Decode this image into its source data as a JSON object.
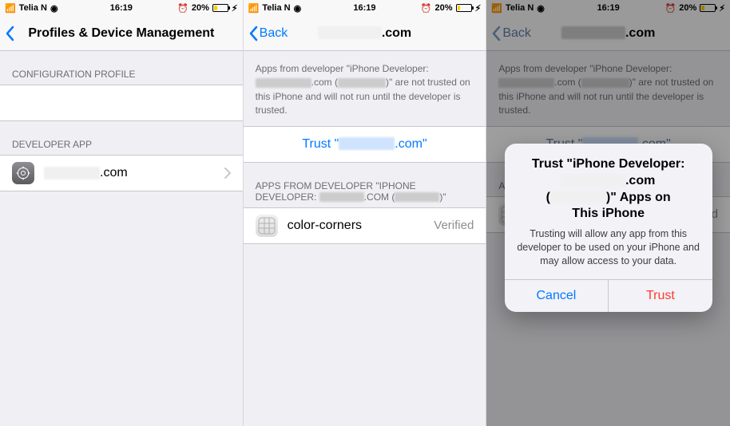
{
  "statusbar": {
    "carrier": "Telia N",
    "time": "16:19",
    "alarm": "⏰",
    "battery_pct": "20%",
    "charging": "⚡︎"
  },
  "screen1": {
    "title": "Profiles & Device Management",
    "section_profile": "CONFIGURATION PROFILE",
    "section_devapp": "DEVELOPER APP",
    "devapp_suffix": ".com"
  },
  "screen2": {
    "back": "Back",
    "title_suffix": ".com",
    "descr_pre": "Apps from developer \"iPhone Developer:",
    "descr_mid_suffix": ".com",
    "descr_paren_open": "(",
    "descr_mid_close": ")\" are not trusted on this iPhone and will not run until the developer is trusted.",
    "trust_pre": "Trust \"",
    "trust_suffix": ".com\"",
    "apps_header_pre": "APPS FROM DEVELOPER \"IPHONE DEVELOPER:",
    "apps_header_suf": ".COM (",
    "apps_header_end": ")\"",
    "app_name": "color-corners",
    "verified": "Verified"
  },
  "screen3": {
    "back": "Back",
    "title_suffix": ".com",
    "apps_header_short": "APPS",
    "verified": "Verified",
    "alert_title_l1": "Trust \"iPhone Developer:",
    "alert_title_l2_suffix": ".com",
    "alert_title_paren_open": "(",
    "alert_title_paren_close": ")\" Apps on",
    "alert_title_l4": "This iPhone",
    "alert_msg": "Trusting will allow any app from this developer to be used on your iPhone and may allow access to your data.",
    "cancel": "Cancel",
    "trust": "Trust"
  }
}
